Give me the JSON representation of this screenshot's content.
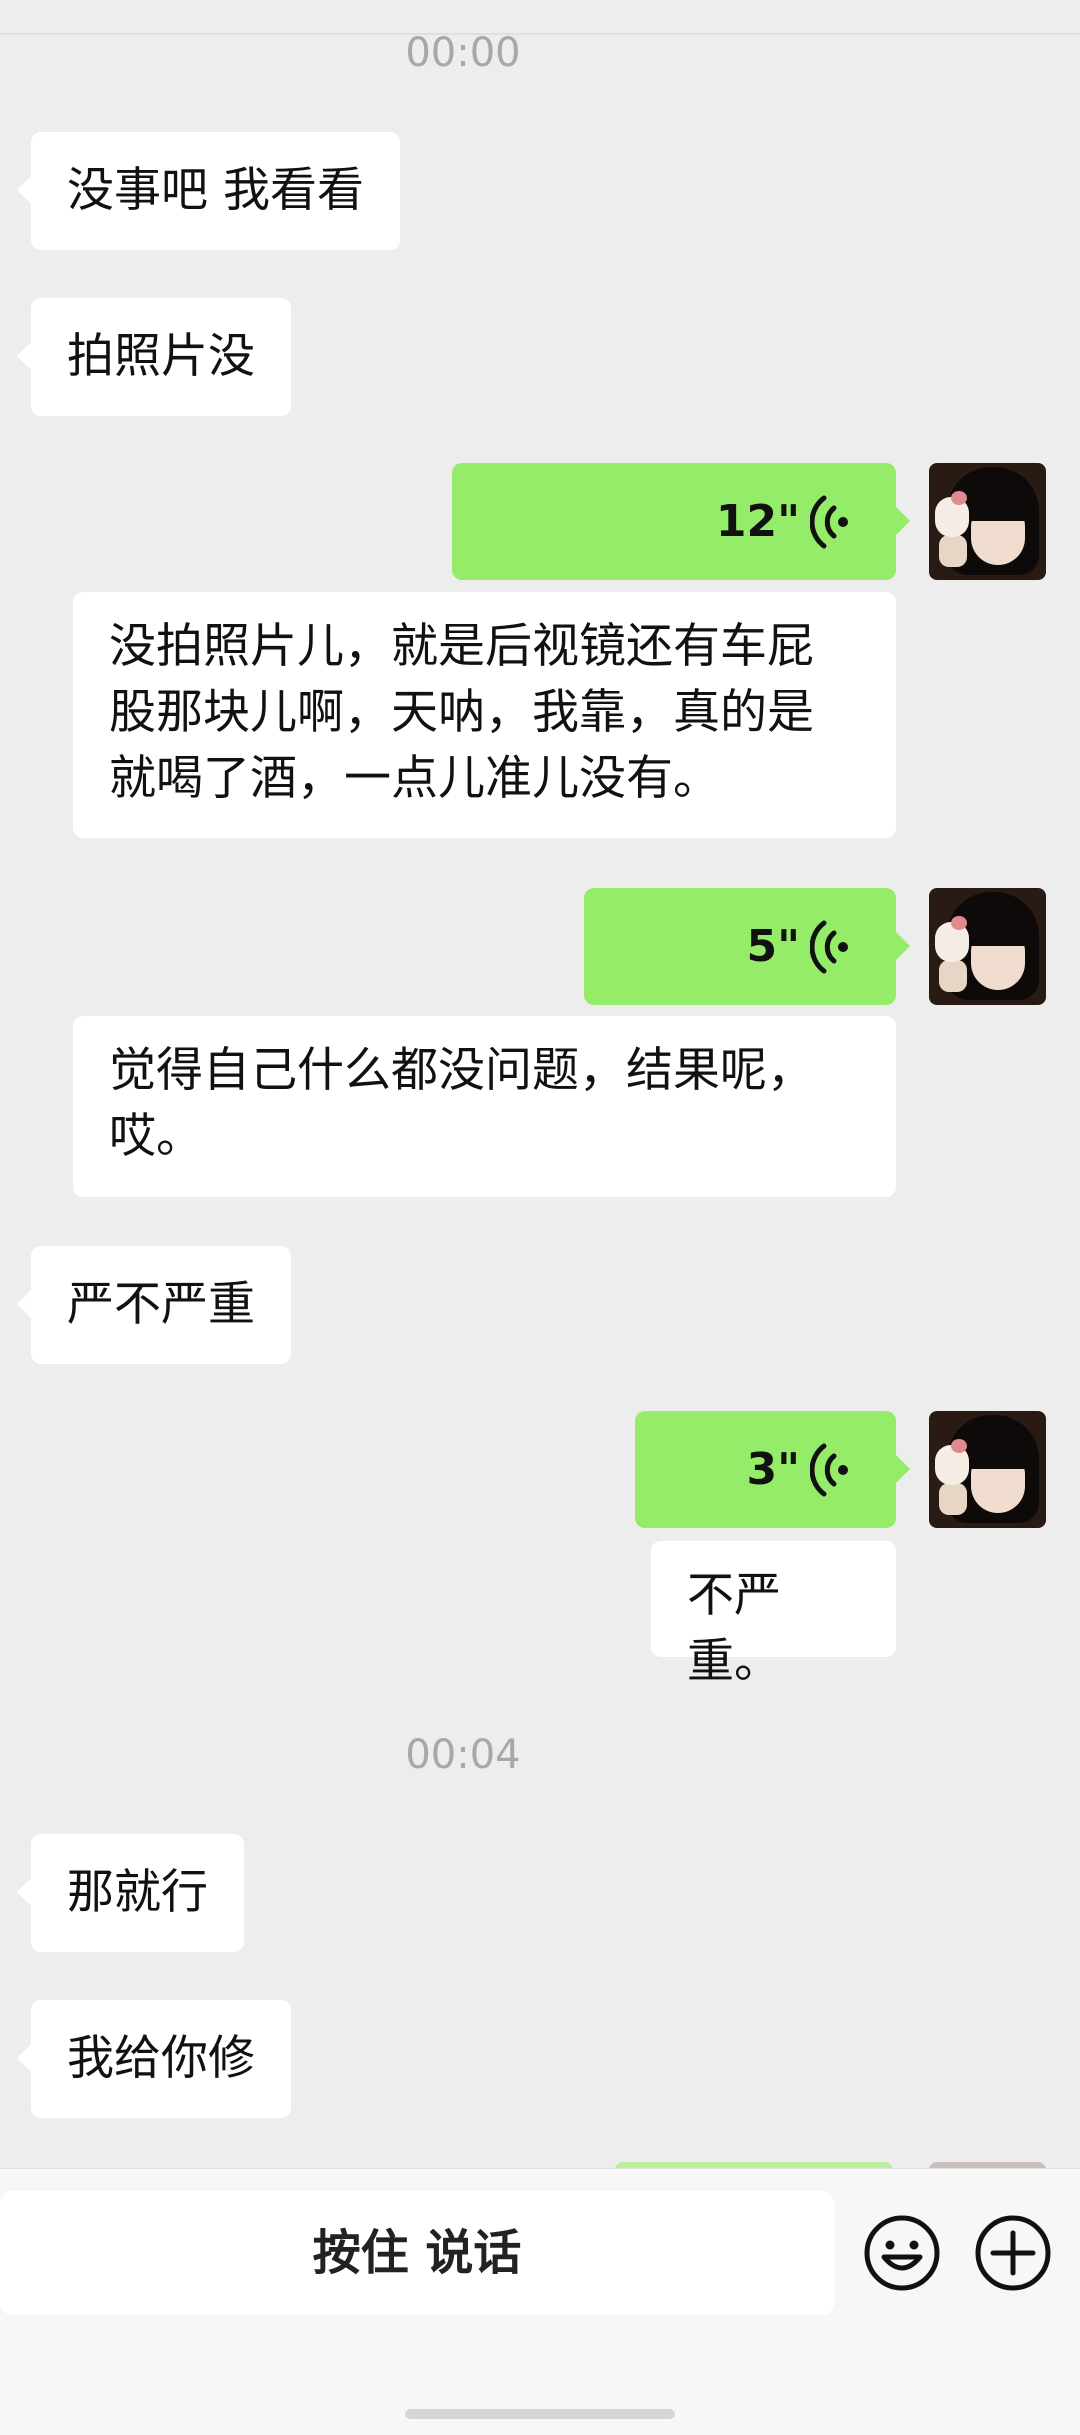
{
  "chat": {
    "timestamps": [
      "00:00",
      "00:04"
    ],
    "incoming": [
      "没事吧 我看看",
      "拍照片没",
      "严不严重",
      "那就行",
      "我给你修"
    ],
    "voice": [
      {
        "duration": "12\"",
        "transcript_line1": "没拍照片儿，就是后视镜还有车屁",
        "transcript_line2": "股那块儿啊，天呐，我靠，真的是",
        "transcript_line3": "就喝了酒，一点儿准儿没有。"
      },
      {
        "duration": "5\"",
        "transcript_line1": "觉得自己什么都没问题，结果呢，",
        "transcript_line2": "哎。"
      },
      {
        "duration": "3\"",
        "transcript_line1": "不严重。"
      }
    ]
  },
  "input_bar": {
    "talk_label": "按住 说话",
    "emoji_icon": "emoji-icon",
    "plus_icon": "plus-icon"
  },
  "colors": {
    "background": "#ededed",
    "sent_bubble": "#95ec69",
    "received_bubble": "#ffffff"
  }
}
